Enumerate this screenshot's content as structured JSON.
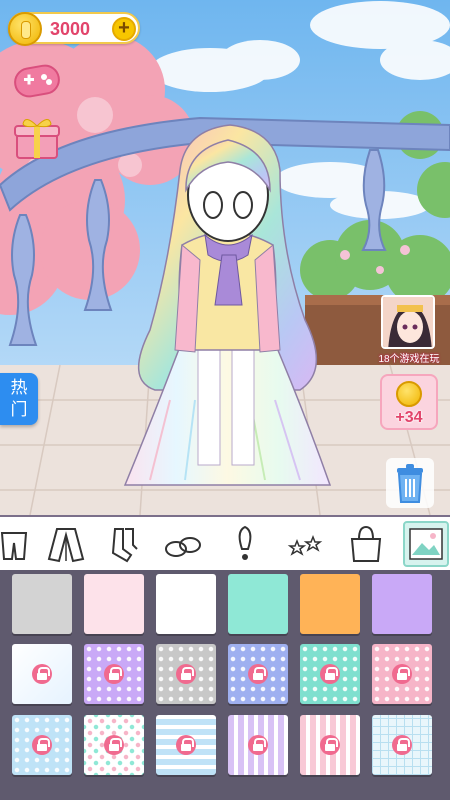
{
  "coins": {
    "amount": "3000",
    "plus": "+"
  },
  "side": {
    "hot_label": "热门"
  },
  "ad": {
    "label": "18个游戏在玩"
  },
  "bonus": {
    "value": "+34"
  },
  "toolbar": {
    "items": [
      {
        "name": "pants-icon"
      },
      {
        "name": "coat-icon"
      },
      {
        "name": "socks-icon"
      },
      {
        "name": "shoes-icon"
      },
      {
        "name": "accessory-icon"
      },
      {
        "name": "stars-effect-icon"
      },
      {
        "name": "bag-icon"
      },
      {
        "name": "background-icon",
        "active": true
      }
    ]
  },
  "palette": {
    "swatches": [
      {
        "kind": "solid",
        "color": "#d3d3d3",
        "locked": false
      },
      {
        "kind": "solid",
        "color": "#fde2ea",
        "locked": false
      },
      {
        "kind": "solid",
        "color": "#ffffff",
        "locked": false
      },
      {
        "kind": "solid",
        "color": "#8fe8d6",
        "locked": false
      },
      {
        "kind": "solid",
        "color": "#ffb357",
        "locked": false
      },
      {
        "kind": "solid",
        "color": "#c9a9f7",
        "locked": false
      },
      {
        "kind": "gradient",
        "color": "#e6f3ff",
        "locked": true
      },
      {
        "kind": "dots",
        "color": "#c9a9f7",
        "locked": true
      },
      {
        "kind": "dots",
        "color": "#c8c8c8",
        "locked": true
      },
      {
        "kind": "dots",
        "color": "#9fb0f0",
        "locked": true
      },
      {
        "kind": "dots",
        "color": "#7fe0cf",
        "locked": true
      },
      {
        "kind": "dots",
        "color": "#f6b5c8",
        "locked": true
      },
      {
        "kind": "dots",
        "color": "#bfe3f7",
        "locked": true
      },
      {
        "kind": "dots-multi",
        "color": "#ffffff",
        "locked": true
      },
      {
        "kind": "waves",
        "color": "#bfe2f7",
        "locked": true
      },
      {
        "kind": "stripes",
        "color": "#d8c2f5",
        "locked": true
      },
      {
        "kind": "stripes",
        "color": "#f8c9d6",
        "locked": true
      },
      {
        "kind": "grid",
        "color": "#e9f6fb",
        "locked": true
      }
    ]
  },
  "colors": {
    "accent_pink": "#e2446b",
    "hot_blue": "#2d8df0",
    "palette_bg": "#5f5a6e"
  }
}
